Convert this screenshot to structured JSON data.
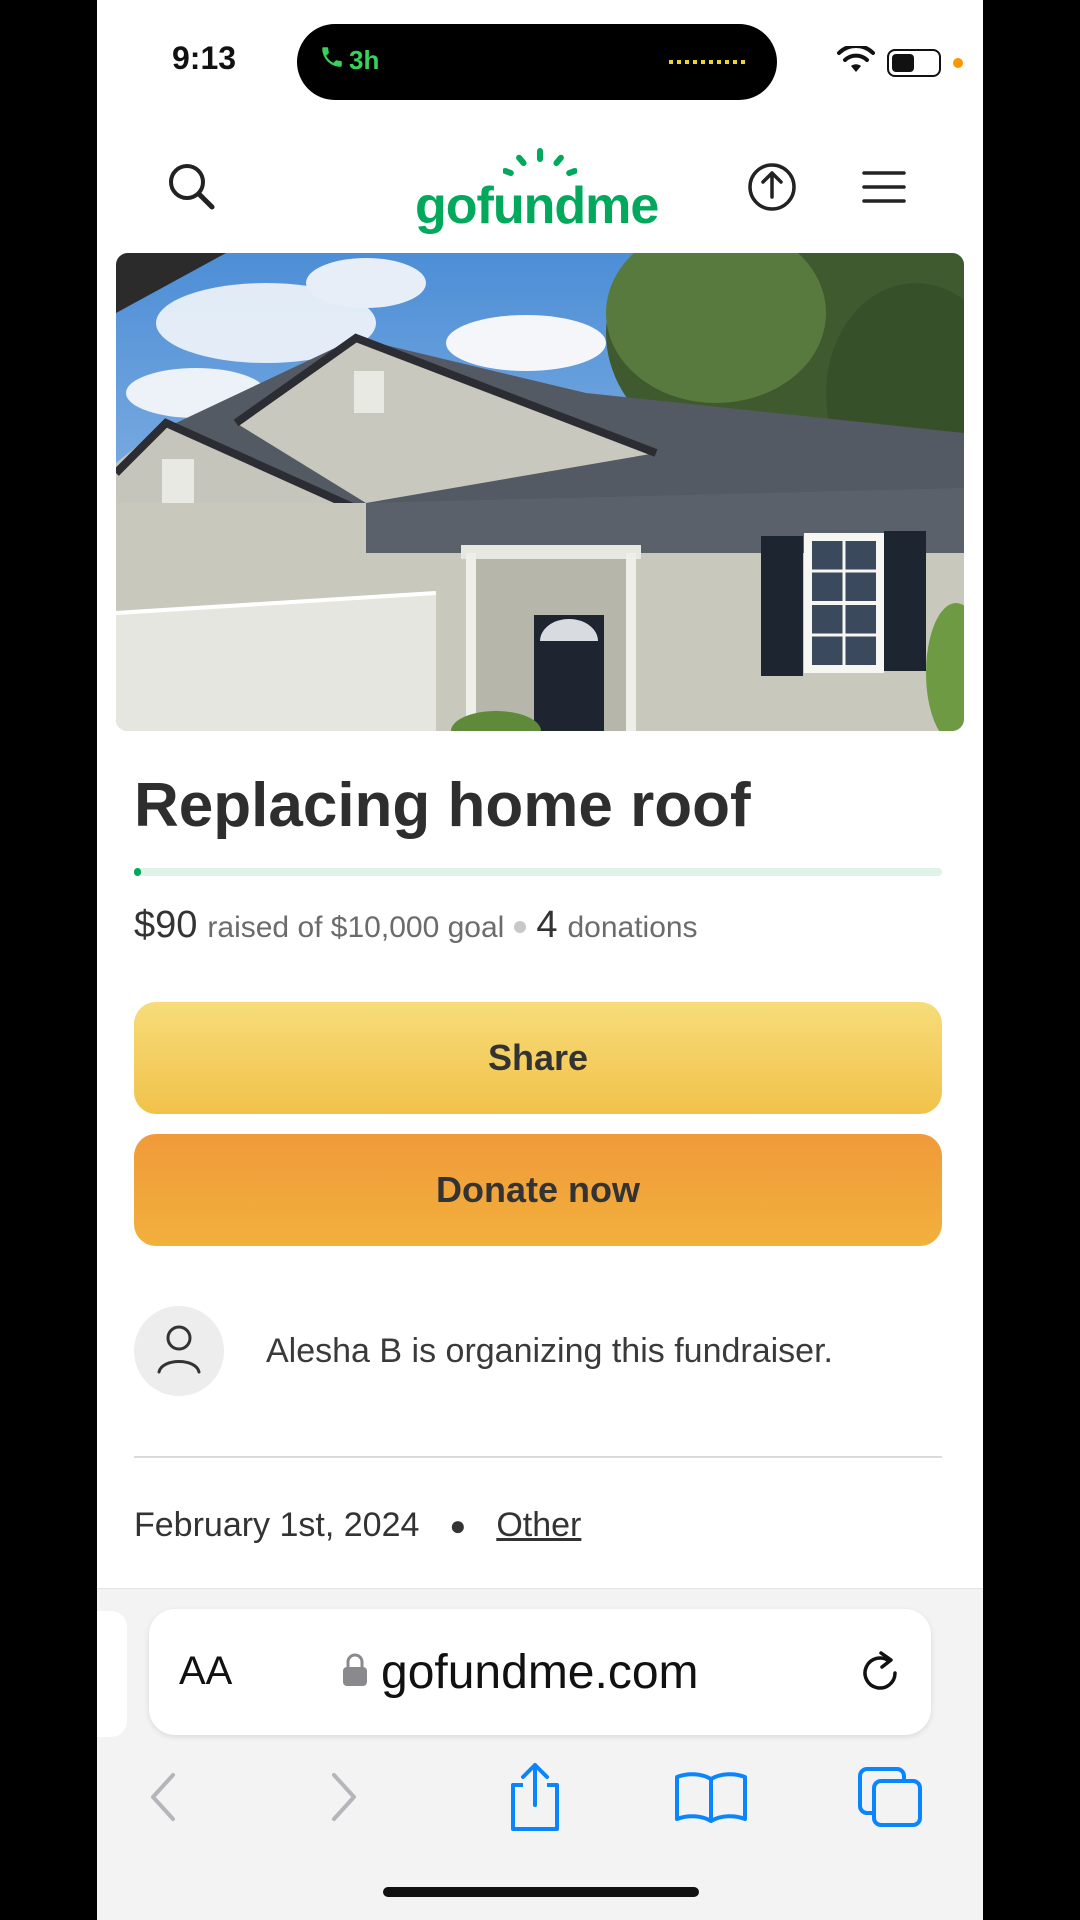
{
  "status_bar": {
    "time": "9:13",
    "call_duration": "3h",
    "icons": [
      "phone-icon",
      "wifi-icon",
      "battery-icon"
    ]
  },
  "header": {
    "logo_text": "gofundme",
    "icons": [
      "search-icon",
      "logo",
      "share-icon",
      "menu-icon"
    ]
  },
  "campaign": {
    "title": "Replacing home roof",
    "raised": "$90",
    "raised_suffix": "raised of $10,000 goal",
    "donation_count": "4",
    "donation_suffix": "donations",
    "progress_fraction": 0.009
  },
  "buttons": {
    "share": "Share",
    "donate": "Donate now"
  },
  "organizer": {
    "text": "Alesha B is organizing this fundraiser."
  },
  "meta": {
    "date": "February 1st, 2024",
    "category": "Other"
  },
  "safari": {
    "aa": "AA",
    "domain": "gofundme.com",
    "toolbar": [
      "back-icon",
      "forward-icon",
      "share-icon",
      "bookmarks-icon",
      "tabs-icon"
    ]
  },
  "colors": {
    "brand_green": "#02a95c",
    "share_yellow": "#f4cf5e",
    "donate_orange": "#f2a23a",
    "safari_blue": "#0a84ff"
  }
}
